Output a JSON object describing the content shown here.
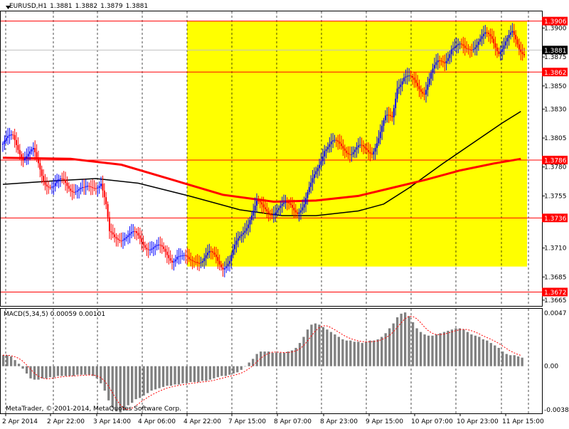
{
  "header": {
    "symbol": "EURUSD,H1",
    "open": "1.3881",
    "high": "1.3882",
    "low": "1.3879",
    "close": "1.3881"
  },
  "macd": {
    "label": "MACD(5,34,5)",
    "main": "0.00059",
    "signal": "0.00101",
    "levels": [
      "0.0047",
      "0.00",
      "-0.00386"
    ]
  },
  "copyright": "MetaTrader, © 2001-2014, MetaQuotes Software Corp.",
  "price_axis": [
    "1.3900",
    "1.3875",
    "1.3850",
    "1.3830",
    "1.3805",
    "1.3780",
    "1.3755",
    "1.3735",
    "1.3710",
    "1.3685",
    "1.3665"
  ],
  "hlines": [
    {
      "price": 1.3906,
      "label": "1.3906"
    },
    {
      "price": 1.3862,
      "label": "1.3862"
    },
    {
      "price": 1.3786,
      "label": "1.3786"
    },
    {
      "price": 1.3736,
      "label": "1.3736"
    },
    {
      "price": 1.3672,
      "label": "1.3672"
    }
  ],
  "current_price": {
    "value": 1.3881,
    "label": "1.3881"
  },
  "time_axis": [
    "2 Apr 2014",
    "2 Apr 22:00",
    "3 Apr 14:00",
    "4 Apr 06:00",
    "4 Apr 22:00",
    "7 Apr 15:00",
    "8 Apr 07:00",
    "8 Apr 23:00",
    "9 Apr 15:00",
    "10 Apr 07:00",
    "10 Apr 23:00",
    "11 Apr 15:00"
  ],
  "colors": {
    "bull": "#0000ff",
    "bear": "#ff0000",
    "highlight": "#ffff00",
    "sma_red": "#ff0000",
    "sma_black": "#000000",
    "macd_hist": "#808080",
    "macd_signal": "#ff0000",
    "hline": "#ff0000"
  },
  "chart_data": {
    "type": "candlestick",
    "symbol": "EURUSD",
    "timeframe": "H1",
    "ylim": [
      1.366,
      1.3915
    ],
    "highlight_range": {
      "from_price": 1.3694,
      "to_price": 1.3906
    },
    "close_path": [
      [
        0,
        1.38
      ],
      [
        6,
        1.3805
      ],
      [
        12,
        1.379
      ],
      [
        18,
        1.3792
      ],
      [
        24,
        1.377
      ],
      [
        30,
        1.3763
      ],
      [
        36,
        1.3767
      ],
      [
        42,
        1.3762
      ],
      [
        48,
        1.3758
      ],
      [
        54,
        1.3765
      ],
      [
        58,
        1.3768
      ],
      [
        61,
        1.3745
      ],
      [
        63,
        1.372
      ],
      [
        66,
        1.3718
      ],
      [
        72,
        1.3722
      ],
      [
        78,
        1.372
      ],
      [
        84,
        1.3714
      ],
      [
        90,
        1.371
      ],
      [
        96,
        1.3706
      ],
      [
        100,
        1.3702
      ],
      [
        103,
        1.3704
      ],
      [
        106,
        1.37
      ],
      [
        110,
        1.3698
      ],
      [
        114,
        1.3702
      ],
      [
        118,
        1.37
      ],
      [
        122,
        1.3703
      ],
      [
        126,
        1.3702
      ],
      [
        130,
        1.3696
      ],
      [
        134,
        1.3698
      ],
      [
        138,
        1.3712
      ],
      [
        142,
        1.3725
      ],
      [
        146,
        1.3738
      ],
      [
        150,
        1.3748
      ],
      [
        154,
        1.3742
      ],
      [
        158,
        1.3742
      ],
      [
        162,
        1.3745
      ],
      [
        166,
        1.3745
      ],
      [
        170,
        1.3746
      ],
      [
        174,
        1.3744
      ],
      [
        178,
        1.3748
      ],
      [
        182,
        1.3762
      ],
      [
        186,
        1.378
      ],
      [
        190,
        1.3798
      ],
      [
        194,
        1.38
      ],
      [
        198,
        1.3798
      ],
      [
        202,
        1.3797
      ],
      [
        206,
        1.3794
      ],
      [
        210,
        1.3795
      ],
      [
        214,
        1.3794
      ],
      [
        218,
        1.3795
      ],
      [
        222,
        1.3806
      ],
      [
        226,
        1.382
      ],
      [
        230,
        1.3823
      ],
      [
        233,
        1.3852
      ],
      [
        237,
        1.3858
      ],
      [
        241,
        1.3854
      ],
      [
        245,
        1.385
      ],
      [
        249,
        1.3847
      ],
      [
        253,
        1.386
      ],
      [
        257,
        1.3868
      ],
      [
        261,
        1.3872
      ],
      [
        265,
        1.3885
      ],
      [
        269,
        1.3883
      ],
      [
        273,
        1.388
      ],
      [
        277,
        1.3885
      ],
      [
        281,
        1.389
      ],
      [
        285,
        1.3892
      ],
      [
        289,
        1.389
      ],
      [
        293,
        1.3882
      ],
      [
        297,
        1.3888
      ],
      [
        301,
        1.3893
      ],
      [
        305,
        1.3883
      ],
      [
        308,
        1.3881
      ]
    ],
    "sma_red": [
      [
        0,
        1.3788
      ],
      [
        40,
        1.3787
      ],
      [
        70,
        1.3782
      ],
      [
        100,
        1.3769
      ],
      [
        130,
        1.3756
      ],
      [
        160,
        1.375
      ],
      [
        185,
        1.3751
      ],
      [
        210,
        1.3755
      ],
      [
        230,
        1.3762
      ],
      [
        250,
        1.3769
      ],
      [
        270,
        1.3777
      ],
      [
        290,
        1.3783
      ],
      [
        306,
        1.3787
      ]
    ],
    "sma_black": [
      [
        0,
        1.3765
      ],
      [
        30,
        1.3768
      ],
      [
        55,
        1.377
      ],
      [
        80,
        1.3766
      ],
      [
        110,
        1.3755
      ],
      [
        140,
        1.3743
      ],
      [
        165,
        1.3738
      ],
      [
        185,
        1.3738
      ],
      [
        210,
        1.3742
      ],
      [
        225,
        1.3748
      ],
      [
        240,
        1.3762
      ],
      [
        260,
        1.3783
      ],
      [
        280,
        1.3803
      ],
      [
        295,
        1.3818
      ],
      [
        306,
        1.3828
      ]
    ],
    "macd_hist": [
      0.0009,
      0.0009,
      0.0008,
      0.0005,
      0.0002,
      -0.0002,
      -0.0006,
      -0.001,
      -0.0011,
      -0.0011,
      -0.001,
      -0.001,
      -0.0009,
      -0.0009,
      -0.0008,
      -0.0008,
      -0.0008,
      -0.0008,
      -0.0008,
      -0.0007,
      -0.0007,
      -0.0007,
      -0.0007,
      -0.0008,
      -0.001,
      -0.0014,
      -0.002,
      -0.0028,
      -0.0034,
      -0.0037,
      -0.0038,
      -0.0036,
      -0.0032,
      -0.003,
      -0.0027,
      -0.0026,
      -0.0024,
      -0.0022,
      -0.002,
      -0.0019,
      -0.0018,
      -0.0017,
      -0.0016,
      -0.0016,
      -0.0015,
      -0.0015,
      -0.0014,
      -0.0014,
      -0.0013,
      -0.0013,
      -0.0013,
      -0.0012,
      -0.0012,
      -0.0011,
      -0.001,
      -0.0009,
      -0.0008,
      -0.0008,
      -0.0007,
      -0.0006,
      -0.0005,
      -0.0003,
      0.0,
      0.0003,
      0.0006,
      0.001,
      0.0012,
      0.0012,
      0.0012,
      0.0011,
      0.0011,
      0.0011,
      0.0011,
      0.0012,
      0.0013,
      0.0015,
      0.0019,
      0.0024,
      0.003,
      0.0034,
      0.0035,
      0.0034,
      0.0032,
      0.003,
      0.0028,
      0.0026,
      0.0024,
      0.0022,
      0.0021,
      0.0021,
      0.002,
      0.002,
      0.0019,
      0.002,
      0.0021,
      0.0021,
      0.0022,
      0.0024,
      0.0027,
      0.0031,
      0.0035,
      0.004,
      0.0043,
      0.0044,
      0.0041,
      0.0036,
      0.0031,
      0.0028,
      0.0026,
      0.0025,
      0.0025,
      0.0026,
      0.0027,
      0.0028,
      0.0029,
      0.003,
      0.0031,
      0.0031,
      0.003,
      0.0028,
      0.0026,
      0.0025,
      0.0024,
      0.0022,
      0.0021,
      0.0019,
      0.0017,
      0.0015,
      0.0012,
      0.001,
      0.0009,
      0.0009,
      0.0008,
      0.0007
    ],
    "macd_ylim": [
      -0.00386,
      0.0047
    ]
  }
}
